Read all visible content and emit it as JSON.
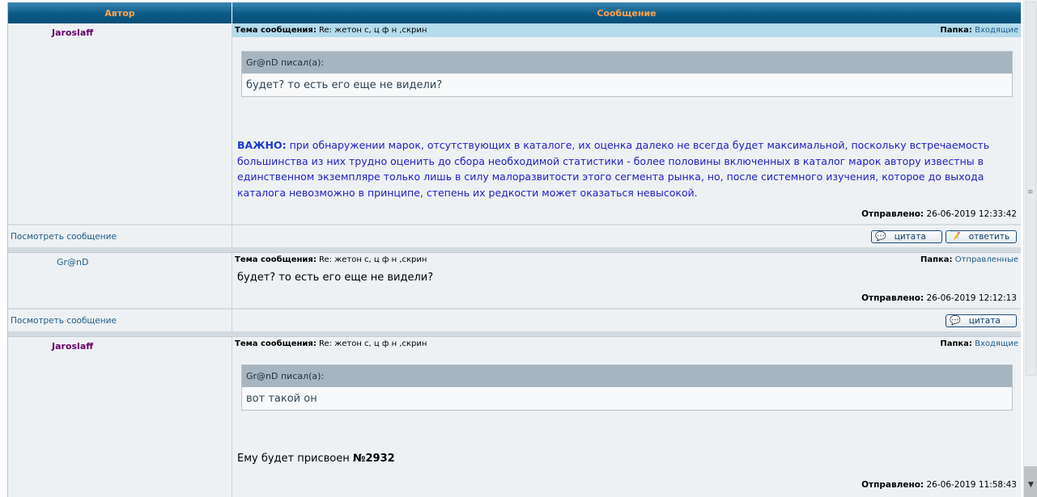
{
  "table_header": {
    "author": "Автор",
    "message": "Сообщение"
  },
  "posts": [
    {
      "author": "Jaroslaff",
      "subject_label": "Тема сообщения:",
      "subject": "Re: жетон с, ц ф н ,скрин",
      "folder_label": "Папка:",
      "folder": "Входящие",
      "quote_author": "Gr@nD писал(а):",
      "quote_text": "будет? то есть его еще не видели?",
      "important_label": "ВАЖНО:",
      "body": "при обнаружении марок, отсутствующих в каталоге, их оценка далеко не всегда будет максимальной, поскольку встречаемость большинства из них трудно оценить до сбора необходимой статистики - более половины включенных в каталог марок автору известны в единственном экземпляре только лишь в силу малоразвитости этого сегмента рынка, но, после системного изучения, которое до выхода каталога невозможно в принципе, степень их редкости может оказаться невысокой.",
      "sent_label": "Отправлено:",
      "sent": "26-06-2019 12:33:42",
      "view_link": "Посмотреть сообщение",
      "quote_button": "цитата",
      "reply_button": "ответить"
    },
    {
      "author": "Gr@nD",
      "subject_label": "Тема сообщения:",
      "subject": "Re: жетон с, ц ф н ,скрин",
      "folder_label": "Папка:",
      "folder": "Отправленные",
      "body": "будет? то есть его еще не видели?",
      "sent_label": "Отправлено:",
      "sent": "26-06-2019 12:12:13",
      "view_link": "Посмотреть сообщение",
      "quote_button": "цитата"
    },
    {
      "author": "Jaroslaff",
      "subject_label": "Тема сообщения:",
      "subject": "Re: жетон с, ц ф н ,скрин",
      "folder_label": "Папка:",
      "folder": "Входящие",
      "quote_author": "Gr@nD писал(а):",
      "quote_text": "вот такой он",
      "body_prefix": "Ему будет присвоен",
      "body_number": "№2932",
      "sent_label": "Отправлено:",
      "sent": "26-06-2019 11:58:43"
    }
  ],
  "icons": {
    "quote": "speech-bubble-icon",
    "reply": "notepad-icon",
    "scroll_down": "arrow-down-icon"
  }
}
